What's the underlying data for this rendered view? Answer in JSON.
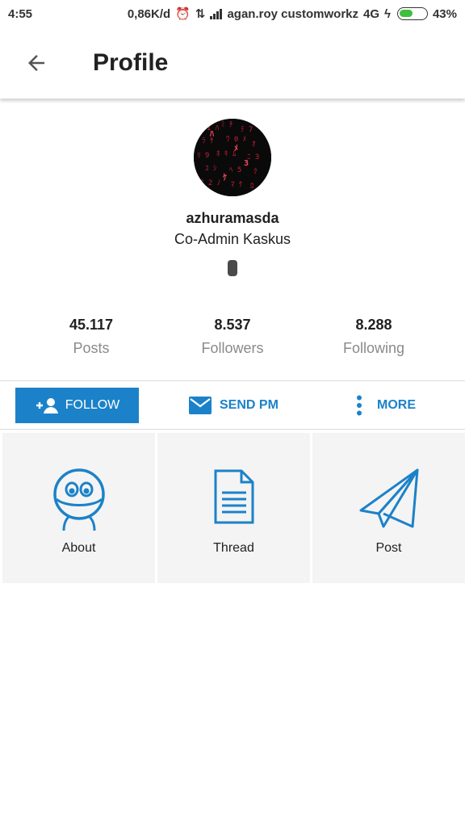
{
  "status_bar": {
    "time": "4:55",
    "net_speed": "0,86K/d",
    "carrier": "agan.roy customworkz",
    "network": "4G",
    "battery": "43%"
  },
  "app_bar": {
    "title": "Profile"
  },
  "profile": {
    "username": "azhuramasda",
    "role": "Co-Admin Kaskus"
  },
  "stats": [
    {
      "value": "45.117",
      "label": "Posts"
    },
    {
      "value": "8.537",
      "label": "Followers"
    },
    {
      "value": "8.288",
      "label": "Following"
    }
  ],
  "actions": {
    "follow": "FOLLOW",
    "send_pm": "SEND PM",
    "more": "MORE"
  },
  "tiles": [
    {
      "label": "About"
    },
    {
      "label": "Thread"
    },
    {
      "label": "Post"
    }
  ],
  "colors": {
    "accent": "#1b82c9",
    "tile_bg": "#f4f4f4",
    "muted_text": "#8a8a8a"
  }
}
